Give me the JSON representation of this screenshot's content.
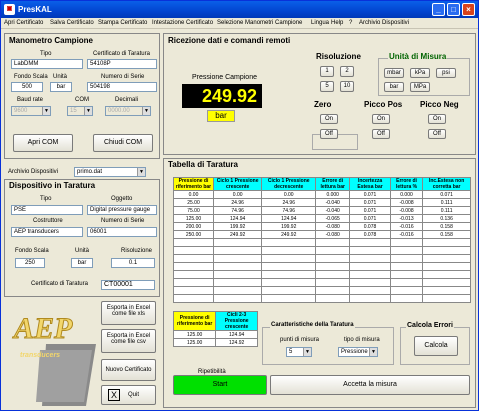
{
  "window": {
    "title": "PresKAL"
  },
  "menu": [
    "Apri Certificato",
    "Salva Certificato",
    "Stampa Certificato",
    "Intestazione Certificato",
    "Selezione Manometri Campione",
    "Lingua",
    "Help",
    "?",
    "Archivio Dispositivi"
  ],
  "campione": {
    "title": "Manometro Campione",
    "tipo_label": "Tipo",
    "tipo": "LabDMM",
    "cert_label": "Certificato di Taratura",
    "cert": "54108P",
    "fondo_label": "Fondo Scala",
    "fondo": "500",
    "unita_label": "Unità",
    "unita": "bar",
    "serie_label": "Numero di Serie",
    "serie": "504198",
    "baud_label": "Baud rate",
    "baud": "9600",
    "com_label": "COM",
    "com": "15",
    "dec_label": "Decimali",
    "dec": "0000.00",
    "apri": "Apri COM",
    "chiudi": "Chiudi COM"
  },
  "archivio": {
    "label": "Archivio Dispositivi",
    "value": "primo.dat"
  },
  "dispositivo": {
    "title": "Dispositivo in Taratura",
    "tipo_label": "Tipo",
    "tipo": "PSE",
    "oggetto_label": "Oggetto",
    "oggetto": "Digital pressure gauge",
    "costr_label": "Costruttore",
    "costr": "AEP transducers",
    "serie_label": "Numero di Serie",
    "serie": "06001",
    "fondo_label": "Fondo Scala",
    "fondo": "250",
    "unita_label": "Unità",
    "unita": "bar",
    "ris_label": "Risoluzione",
    "ris": "0.1",
    "cert_label": "Certificato di Taratura",
    "cert": "CT00001"
  },
  "buttons": {
    "xls": "Esporta in Excel come file xls",
    "csv": "Esporta in Excel come file csv",
    "nuovo": "Nuovo Certificato",
    "quit": "Quit",
    "quit_x": "X",
    "start": "Start",
    "accetta": "Accetta la misura",
    "calcola": "Calcola"
  },
  "logo": {
    "text": "AEP",
    "sub": "transducers"
  },
  "ricezione": {
    "title": "Ricezione dati e comandi remoti",
    "pressione_label": "Pressione Campione",
    "pressione": "249.92",
    "unit": "bar"
  },
  "risoluzione": {
    "title": "Risoluzione",
    "buttons": [
      "1",
      "2",
      "5",
      "10"
    ]
  },
  "unita": {
    "title": "Unità di Misura",
    "buttons": [
      "mbar",
      "kPa",
      "psi",
      "bar",
      "MPa"
    ]
  },
  "zero": {
    "title": "Zero",
    "on": "On",
    "off": "Off"
  },
  "piccopos": {
    "title": "Picco Pos",
    "on": "On",
    "off": "Off"
  },
  "picconeg": {
    "title": "Picco Neg",
    "on": "On",
    "off": "Off"
  },
  "tabella": {
    "title": "Tabella di Taratura",
    "headers": [
      "Pressione di riferimento bar",
      "Ciclo 1 Pressione crescente",
      "Ciclo 1 Pressione decrescente",
      "Errore di lettura bar",
      "Incertezza Estesa bar",
      "Errore di lettura %",
      "Inc.Estesa non corretta bar"
    ],
    "rows": [
      [
        "0.00",
        "0.00",
        "0.00",
        "0.000",
        "0.071",
        "0.000",
        "0.071"
      ],
      [
        "25.00",
        "24.96",
        "24.96",
        "-0.040",
        "0.071",
        "-0.008",
        "0.111"
      ],
      [
        "75.00",
        "74.96",
        "74.96",
        "-0.040",
        "0.071",
        "-0.008",
        "0.111"
      ],
      [
        "125.00",
        "124.94",
        "124.94",
        "-0.065",
        "0.071",
        "-0.013",
        "0.136"
      ],
      [
        "200.00",
        "199.92",
        "199.92",
        "-0.080",
        "0.078",
        "-0.016",
        "0.158"
      ],
      [
        "250.00",
        "249.92",
        "249.92",
        "-0.080",
        "0.078",
        "-0.016",
        "0.158"
      ]
    ]
  },
  "small": {
    "headers": [
      "Pressione di riferimento bar",
      "Cicli 2-3 Pressione crescente"
    ],
    "rows": [
      [
        "125.00",
        "124.94"
      ],
      [
        "125.00",
        "124.92"
      ]
    ],
    "ripetibilita": "Ripetibilità"
  },
  "caratt": {
    "title": "Caratteristiche della Taratura",
    "punti_label": "punti di misura",
    "punti": "5",
    "tipo_label": "tipo di misura",
    "tipo": "Pressione"
  },
  "errori": {
    "title": "Calcola Errori"
  }
}
